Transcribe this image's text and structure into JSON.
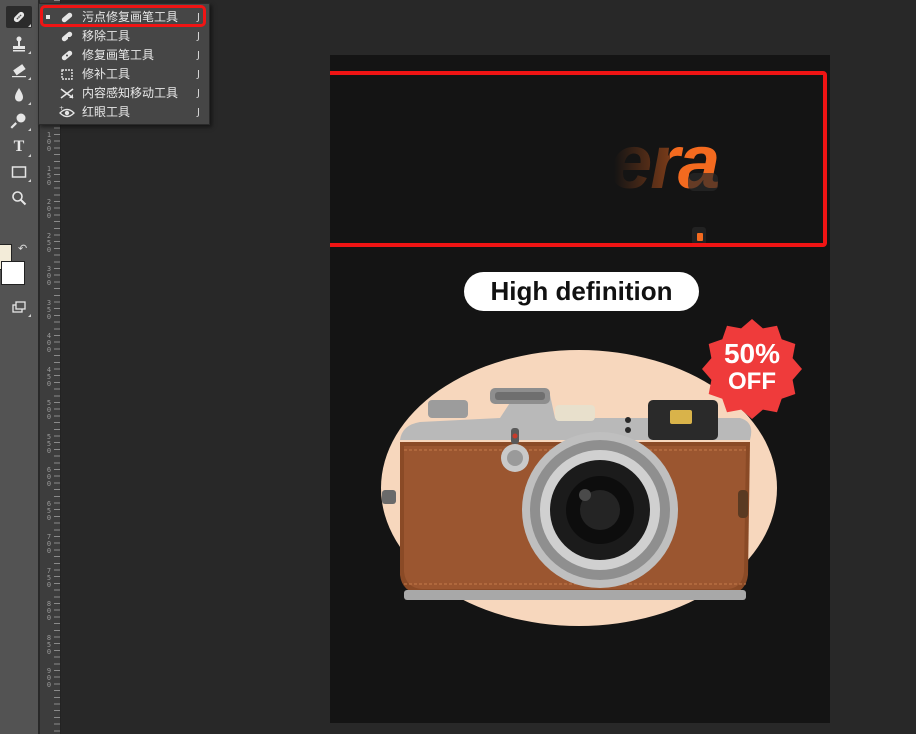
{
  "flyout_menu": {
    "items": [
      {
        "label": "污点修复画笔工具",
        "shortcut": "J",
        "icon": "spot-healing-brush-icon",
        "active": true
      },
      {
        "label": "移除工具",
        "shortcut": "J",
        "icon": "remove-tool-icon"
      },
      {
        "label": "修复画笔工具",
        "shortcut": "J",
        "icon": "healing-brush-icon"
      },
      {
        "label": "修补工具",
        "shortcut": "J",
        "icon": "patch-tool-icon"
      },
      {
        "label": "内容感知移动工具",
        "shortcut": "J",
        "icon": "content-aware-move-icon"
      },
      {
        "label": "红眼工具",
        "shortcut": "J",
        "icon": "red-eye-icon"
      }
    ]
  },
  "toolbar": {
    "tools": [
      "spot-healing-brush-icon",
      "clone-stamp-icon",
      "eraser-icon",
      "blur-drop-icon",
      "dodge-icon",
      "type-icon",
      "rectangle-icon",
      "zoom-icon",
      "swap-colors-icon",
      "screen-mode-icon"
    ],
    "type_tool_glyph": "T",
    "foreground_color": "#f3ecd9",
    "background_color": "#ffffff"
  },
  "ruler": {
    "labels": [
      "1\n0\n0",
      "1\n5\n0",
      "2\n0\n0",
      "2\n5\n0",
      "3\n0\n0",
      "3\n5\n0",
      "4\n0\n0",
      "4\n5\n0",
      "5\n0\n0",
      "5\n5\n0",
      "6\n0\n0",
      "6\n5\n0",
      "7\n0\n0",
      "7\n5\n0",
      "8\n0\n0",
      "8\n5\n0",
      "9\n0\n0"
    ]
  },
  "canvas": {
    "headline_partial": "era",
    "pill_text": "High definition",
    "badge_percent": "50%",
    "badge_off": "OFF",
    "colors": {
      "background": "#141414",
      "accent_orange": "#f36a1f",
      "badge_red": "#ef3b3b",
      "oval": "#f7d7bd",
      "highlight_red": "#f01414"
    }
  }
}
